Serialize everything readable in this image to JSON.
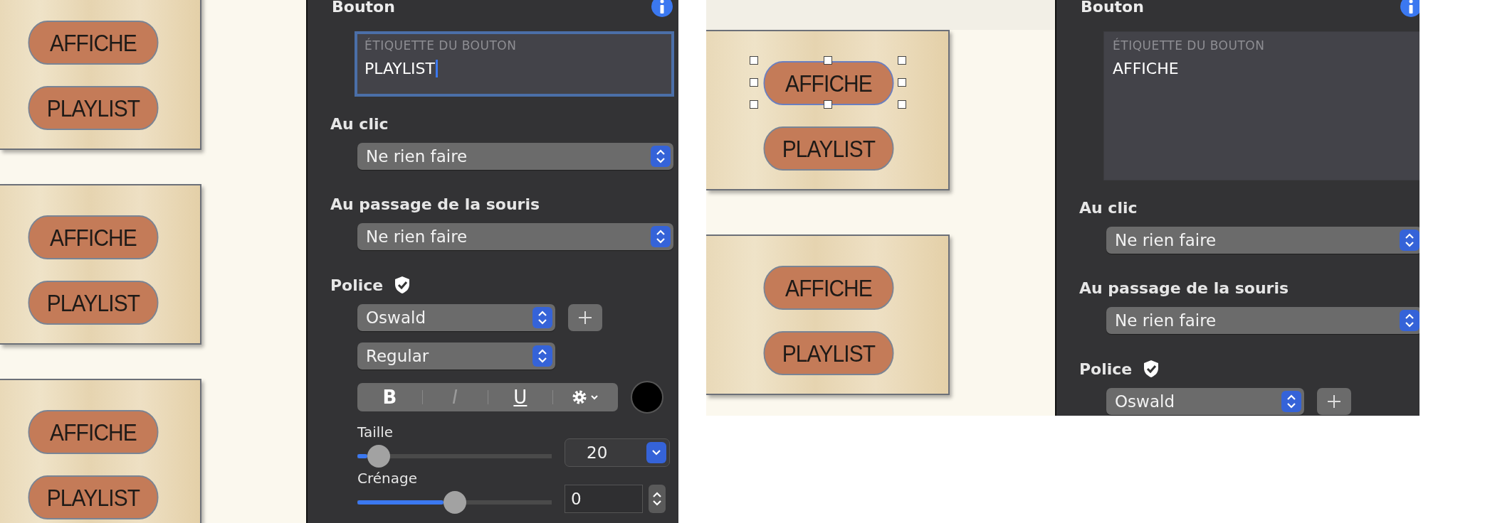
{
  "screens": [
    {
      "canvas": {
        "cards": [
          {
            "buttons": [
              {
                "label": "AFFICHE",
                "selected": false
              },
              {
                "label": "PLAYLIST",
                "selected": false
              }
            ]
          },
          {
            "buttons": [
              {
                "label": "AFFICHE",
                "selected": false
              },
              {
                "label": "PLAYLIST",
                "selected": false
              }
            ]
          },
          {
            "buttons": [
              {
                "label": "AFFICHE",
                "selected": false
              },
              {
                "label": "PLAYLIST",
                "selected": false
              }
            ]
          }
        ]
      },
      "inspector": {
        "title": "Bouton",
        "rows": [
          {
            "kind": "text-field",
            "caption": "ÉTIQUETTE DU BOUTON",
            "value": "PLAYLIST",
            "focused": true
          },
          {
            "kind": "section",
            "label": "Au clic",
            "verified": false
          },
          {
            "kind": "select",
            "value": "Ne rien faire"
          },
          {
            "kind": "section",
            "label": "Au passage de la souris",
            "verified": false
          },
          {
            "kind": "select",
            "value": "Ne rien faire"
          },
          {
            "kind": "section",
            "label": "Police",
            "verified": true
          },
          {
            "kind": "font-select",
            "value": "Oswald"
          },
          {
            "kind": "short-select",
            "value": "Regular"
          },
          {
            "kind": "style-bar",
            "bold": "B",
            "italic": "I",
            "underline": "U",
            "color": "#000000"
          },
          {
            "kind": "slider",
            "label": "Taille",
            "level": 0.11,
            "value": "20"
          },
          {
            "kind": "stepper-slider",
            "label": "Crénage",
            "level": 0.5,
            "value": "0"
          }
        ]
      }
    },
    {
      "canvas": {
        "cards": [
          {
            "buttons": [
              {
                "label": "AFFICHE",
                "selected": true
              },
              {
                "label": "PLAYLIST",
                "selected": false
              }
            ]
          },
          {
            "buttons": [
              {
                "label": "AFFICHE",
                "selected": false
              },
              {
                "label": "PLAYLIST",
                "selected": false
              }
            ]
          }
        ]
      },
      "inspector": {
        "title": "Bouton",
        "rows": [
          {
            "kind": "text-area",
            "caption": "ÉTIQUETTE DU BOUTON",
            "value": "AFFICHE",
            "focused": false
          },
          {
            "kind": "section",
            "label": "Au clic",
            "verified": false
          },
          {
            "kind": "select",
            "value": "Ne rien faire"
          },
          {
            "kind": "section",
            "label": "Au passage de la souris",
            "verified": false
          },
          {
            "kind": "select",
            "value": "Ne rien faire"
          },
          {
            "kind": "section",
            "label": "Police",
            "verified": true
          },
          {
            "kind": "font-select",
            "value": "Oswald"
          }
        ]
      }
    }
  ]
}
